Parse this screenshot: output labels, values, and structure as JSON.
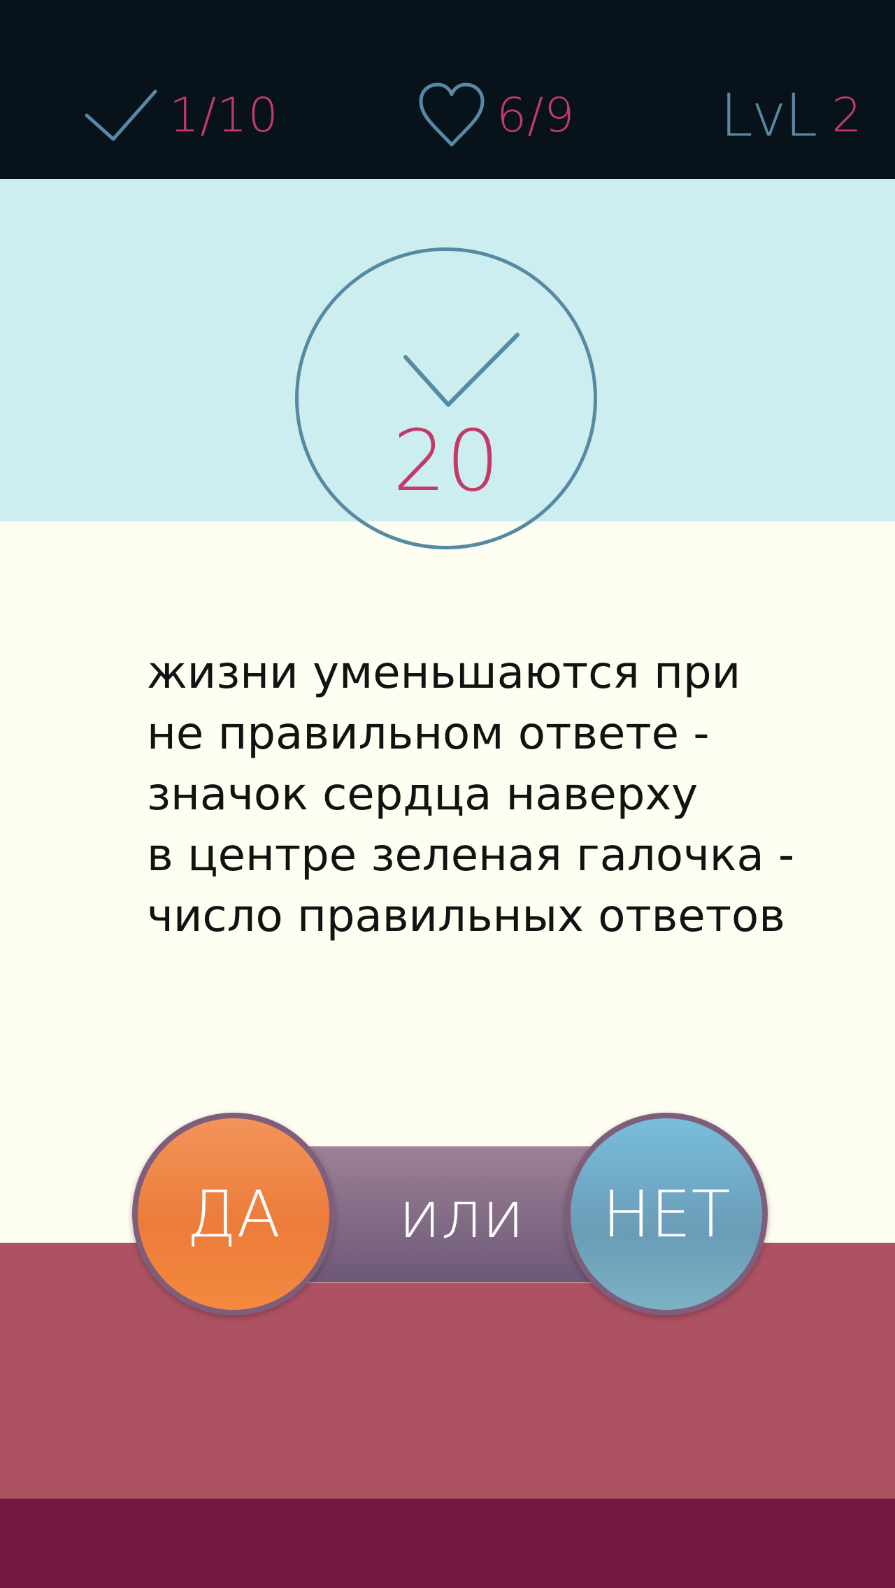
{
  "header": {
    "correct_count": "1/10",
    "lives": "6/9",
    "level_label": "LvL",
    "level_value": "2"
  },
  "score": {
    "value": "20"
  },
  "question": {
    "text": "жизни уменьшаются при\nне правильном ответе -\nзначок сердца наверху\nв центре  зеленая галочка -\nчисло правильных ответов"
  },
  "controls": {
    "yes_label": "ДА",
    "or_label": "или",
    "no_label": "НЕТ"
  },
  "colors": {
    "topbar": "#07121a",
    "accent_pink": "#c23a68",
    "accent_blue": "#568aa3",
    "sky": "#cdeef1",
    "cream": "#fdfdf1",
    "rose": "#ad5262",
    "plum": "#741840",
    "yes_orange": "#ec7c3a",
    "no_blue": "#6a9cb7"
  },
  "icons": {
    "correct": "check-icon",
    "lives": "heart-icon",
    "score": "check-icon"
  }
}
